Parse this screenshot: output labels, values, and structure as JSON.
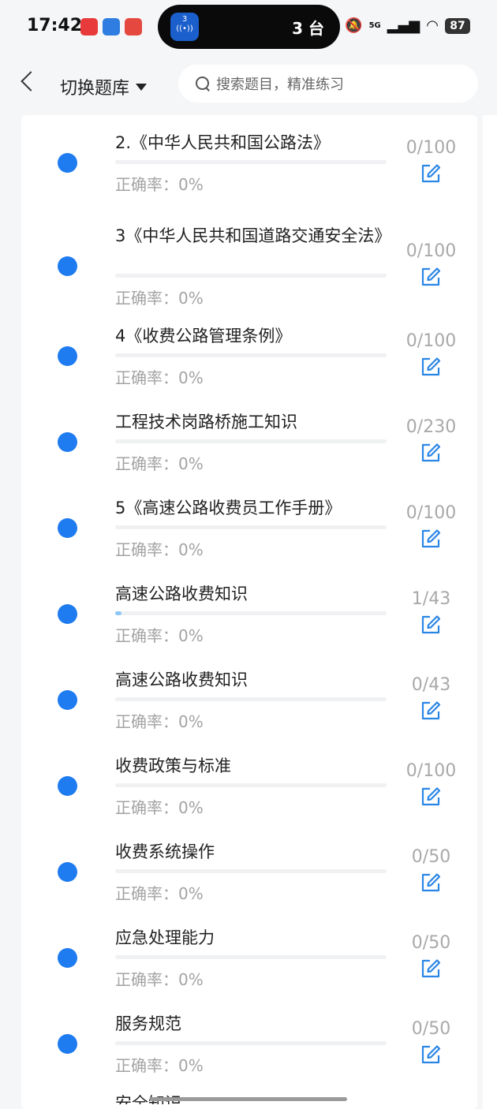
{
  "status": {
    "time": "17:42",
    "island_text": "3 台",
    "island_badge": "3",
    "network": "5G",
    "battery": "87"
  },
  "header": {
    "switch_label": "切换题库",
    "search_placeholder": "搜索题目，精准练习"
  },
  "items": [
    {
      "title": "2.《中华人民共和国公路法》",
      "accuracy": "正确率：0%",
      "count": "0/100",
      "progress": 0
    },
    {
      "title": "3《中华人民共和国道路交通安全法》",
      "accuracy": "正确率：0%",
      "count": "0/100",
      "progress": 0
    },
    {
      "title": "4《收费公路管理条例》",
      "accuracy": "正确率：0%",
      "count": "0/100",
      "progress": 0
    },
    {
      "title": "工程技术岗路桥施工知识",
      "accuracy": "正确率：0%",
      "count": "0/230",
      "progress": 0
    },
    {
      "title": "5《高速公路收费员工作手册》",
      "accuracy": "正确率：0%",
      "count": "0/100",
      "progress": 0
    },
    {
      "title": "高速公路收费知识",
      "accuracy": "正确率：0%",
      "count": "1/43",
      "progress": 0.023
    },
    {
      "title": "高速公路收费知识",
      "accuracy": "正确率：0%",
      "count": "0/43",
      "progress": 0
    },
    {
      "title": "收费政策与标准",
      "accuracy": "正确率：0%",
      "count": "0/100",
      "progress": 0
    },
    {
      "title": "收费系统操作",
      "accuracy": "正确率：0%",
      "count": "0/50",
      "progress": 0
    },
    {
      "title": "应急处理能力",
      "accuracy": "正确率：0%",
      "count": "0/50",
      "progress": 0
    },
    {
      "title": "服务规范",
      "accuracy": "正确率：0%",
      "count": "0/50",
      "progress": 0
    }
  ],
  "partial_item_title": "安全知识",
  "colors": {
    "dot": "#1e7bf0",
    "edit_icon": "#2a86e6",
    "progress_fill": "#8ec5f3"
  }
}
